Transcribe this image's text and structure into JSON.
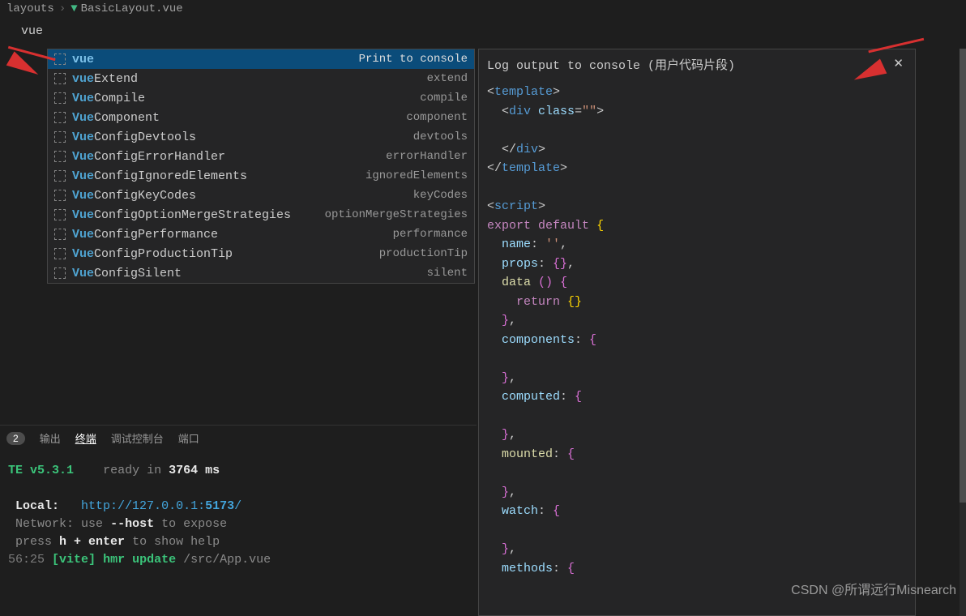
{
  "breadcrumb": {
    "folder": "layouts",
    "file": "BasicLayout.vue"
  },
  "editor": {
    "typed": "vue"
  },
  "suggestions": [
    {
      "match": "vue",
      "rest": "",
      "detail": "Print to console",
      "selected": true
    },
    {
      "match": "vue",
      "rest": "Extend",
      "detail": "extend"
    },
    {
      "match": "Vue",
      "rest": "Compile",
      "detail": "compile"
    },
    {
      "match": "Vue",
      "rest": "Component",
      "detail": "component"
    },
    {
      "match": "Vue",
      "rest": "ConfigDevtools",
      "detail": "devtools"
    },
    {
      "match": "Vue",
      "rest": "ConfigErrorHandler",
      "detail": "errorHandler"
    },
    {
      "match": "Vue",
      "rest": "ConfigIgnoredElements",
      "detail": "ignoredElements"
    },
    {
      "match": "Vue",
      "rest": "ConfigKeyCodes",
      "detail": "keyCodes"
    },
    {
      "match": "Vue",
      "rest": "ConfigOptionMergeStrategies",
      "detail": "optionMergeStrategies"
    },
    {
      "match": "Vue",
      "rest": "ConfigPerformance",
      "detail": "performance"
    },
    {
      "match": "Vue",
      "rest": "ConfigProductionTip",
      "detail": "productionTip"
    },
    {
      "match": "Vue",
      "rest": "ConfigSilent",
      "detail": "silent"
    }
  ],
  "doc": {
    "title": "Log output to console (用户代码片段)",
    "lines": [
      [
        {
          "t": "<",
          "c": "punct"
        },
        {
          "t": "template",
          "c": "tag"
        },
        {
          "t": ">",
          "c": "punct"
        }
      ],
      [
        {
          "t": "  <",
          "c": "punct"
        },
        {
          "t": "div",
          "c": "tag"
        },
        {
          "t": " ",
          "c": "punct"
        },
        {
          "t": "class",
          "c": "attr"
        },
        {
          "t": "=",
          "c": "punct"
        },
        {
          "t": "\"\"",
          "c": "string"
        },
        {
          "t": ">",
          "c": "punct"
        }
      ],
      [],
      [
        {
          "t": "  </",
          "c": "punct"
        },
        {
          "t": "div",
          "c": "tag"
        },
        {
          "t": ">",
          "c": "punct"
        }
      ],
      [
        {
          "t": "</",
          "c": "punct"
        },
        {
          "t": "template",
          "c": "tag"
        },
        {
          "t": ">",
          "c": "punct"
        }
      ],
      [],
      [
        {
          "t": "<",
          "c": "punct"
        },
        {
          "t": "script",
          "c": "tag"
        },
        {
          "t": ">",
          "c": "punct"
        }
      ],
      [
        {
          "t": "export",
          "c": "keyword"
        },
        {
          "t": " ",
          "c": "punct"
        },
        {
          "t": "default",
          "c": "keyword"
        },
        {
          "t": " ",
          "c": "punct"
        },
        {
          "t": "{",
          "c": "bracket"
        }
      ],
      [
        {
          "t": "  ",
          "c": "punct"
        },
        {
          "t": "name",
          "c": "prop"
        },
        {
          "t": ": ",
          "c": "punct"
        },
        {
          "t": "''",
          "c": "string"
        },
        {
          "t": ",",
          "c": "punct"
        }
      ],
      [
        {
          "t": "  ",
          "c": "punct"
        },
        {
          "t": "props",
          "c": "prop"
        },
        {
          "t": ": ",
          "c": "punct"
        },
        {
          "t": "{}",
          "c": "bracket2"
        },
        {
          "t": ",",
          "c": "punct"
        }
      ],
      [
        {
          "t": "  ",
          "c": "punct"
        },
        {
          "t": "data",
          "c": "func"
        },
        {
          "t": " ",
          "c": "punct"
        },
        {
          "t": "()",
          "c": "bracket2"
        },
        {
          "t": " ",
          "c": "punct"
        },
        {
          "t": "{",
          "c": "bracket2"
        }
      ],
      [
        {
          "t": "    ",
          "c": "punct"
        },
        {
          "t": "return",
          "c": "keyword"
        },
        {
          "t": " ",
          "c": "punct"
        },
        {
          "t": "{}",
          "c": "bracket"
        }
      ],
      [
        {
          "t": "  ",
          "c": "punct"
        },
        {
          "t": "}",
          "c": "bracket2"
        },
        {
          "t": ",",
          "c": "punct"
        }
      ],
      [
        {
          "t": "  ",
          "c": "punct"
        },
        {
          "t": "components",
          "c": "prop"
        },
        {
          "t": ": ",
          "c": "punct"
        },
        {
          "t": "{",
          "c": "bracket2"
        }
      ],
      [],
      [
        {
          "t": "  ",
          "c": "punct"
        },
        {
          "t": "}",
          "c": "bracket2"
        },
        {
          "t": ",",
          "c": "punct"
        }
      ],
      [
        {
          "t": "  ",
          "c": "punct"
        },
        {
          "t": "computed",
          "c": "prop"
        },
        {
          "t": ": ",
          "c": "punct"
        },
        {
          "t": "{",
          "c": "bracket2"
        }
      ],
      [],
      [
        {
          "t": "  ",
          "c": "punct"
        },
        {
          "t": "}",
          "c": "bracket2"
        },
        {
          "t": ",",
          "c": "punct"
        }
      ],
      [
        {
          "t": "  ",
          "c": "punct"
        },
        {
          "t": "mounted",
          "c": "func"
        },
        {
          "t": ": ",
          "c": "punct"
        },
        {
          "t": "{",
          "c": "bracket2"
        }
      ],
      [],
      [
        {
          "t": "  ",
          "c": "punct"
        },
        {
          "t": "}",
          "c": "bracket2"
        },
        {
          "t": ",",
          "c": "punct"
        }
      ],
      [
        {
          "t": "  ",
          "c": "punct"
        },
        {
          "t": "watch",
          "c": "prop"
        },
        {
          "t": ": ",
          "c": "punct"
        },
        {
          "t": "{",
          "c": "bracket2"
        }
      ],
      [],
      [
        {
          "t": "  ",
          "c": "punct"
        },
        {
          "t": "}",
          "c": "bracket2"
        },
        {
          "t": ",",
          "c": "punct"
        }
      ],
      [
        {
          "t": "  ",
          "c": "punct"
        },
        {
          "t": "methods",
          "c": "prop"
        },
        {
          "t": ": ",
          "c": "punct"
        },
        {
          "t": "{",
          "c": "bracket2"
        }
      ]
    ]
  },
  "panel": {
    "badge": "2",
    "tabs": [
      "输出",
      "终端",
      "调试控制台",
      "端口"
    ],
    "active": 1
  },
  "terminal": {
    "line1_prefix": "TE",
    "line1_version": "v5.3.1",
    "line1_mid": "ready in",
    "line1_time": "3764",
    "line1_unit": "ms",
    "local_label": "Local:",
    "local_url_a": "http://127.0.0.1:",
    "local_url_b": "5173",
    "local_url_c": "/",
    "network_label": "Network:",
    "network_use": "use",
    "network_flag": "--host",
    "network_rest": "to expose",
    "help_a": "press",
    "help_b": "h + enter",
    "help_c": "to show help",
    "hmr_time": "56:25",
    "hmr_vite": "[vite]",
    "hmr_msg": "hmr update",
    "hmr_path": "/src/App.vue"
  },
  "watermark": "CSDN @所谓远行Misnearch"
}
